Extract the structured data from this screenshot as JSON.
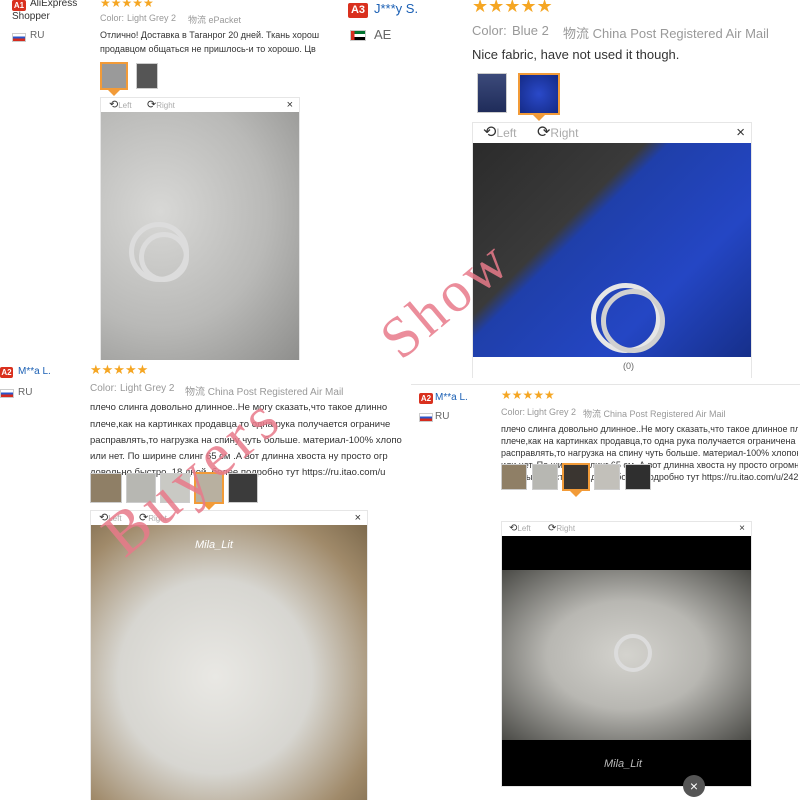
{
  "reviews": [
    {
      "badge": "A1",
      "name_line1": "AliExpress",
      "name_line2": "Shopper",
      "country": "RU",
      "stars": "★★★★★",
      "color_label": "Color:",
      "color_value": "Light Grey 2",
      "shipping": "物流 ePacket",
      "text_line1": "Отлично! Доставка в Таганрог 20 дней. Ткань хорош",
      "text_line2": "продавцом общаться не пришлось-и то хорошо. Цв",
      "viewer_left": "Left",
      "viewer_right": "Right",
      "close": "×"
    },
    {
      "badge": "A3",
      "name": "J***y S.",
      "country": "AE",
      "stars": "★★★★★",
      "color_label": "Color:",
      "color_value": "Blue 2",
      "shipping": "物流 China Post Registered Air Mail",
      "text_line1": "Nice fabric, have not used it though.",
      "viewer_left": "Left",
      "viewer_right": "Right",
      "close": "×",
      "helpful": "(0)"
    },
    {
      "badge": "A2",
      "name": "M**a L.",
      "country": "RU",
      "stars": "★★★★★",
      "color_label": "Color:",
      "color_value": "Light Grey 2",
      "shipping": "物流 China Post Registered Air Mail",
      "text_line1": "плечо слинга довольно длинное..Не могу сказать,что такое длинно",
      "text_line2": "плече,как на картинках продавца,то одна рука получается ограниче",
      "text_line3": "расправлять,то нагрузка на спину чуть больше. материал-100% хлопо",
      "text_line4": "или нет. По ширине слинг 65 см .А вот длинна хвоста ну просто огр",
      "text_line5": "довольно быстро. 18 дней. более подробно тут https://ru.itao.com/u",
      "viewer_left": "Left",
      "viewer_right": "Right",
      "close": "×",
      "photo_caption": "Mila_Lit"
    },
    {
      "badge": "A2",
      "name": "M**a L.",
      "country": "RU",
      "stars": "★★★★★",
      "color_label": "Color:",
      "color_value": "Light Grey 2",
      "shipping": "物流 China Post Registered Air Mail",
      "text_line1": "плечо слинга довольно длинное..Не могу сказать,что такое длинное пле",
      "text_line2": "плече,как на картинках продавца,то одна рука получается ограничена",
      "text_line3": "расправлять,то нагрузка на спину чуть больше. материал-100% хлопок",
      "text_line4": "или нет. По ширине слинг 65 см .А вот длинна хвоста ну просто огромн",
      "text_line5": "довольно быстро. 18 дней. более подробно тут https://ru.itao.com/u/242",
      "viewer_left": "Left",
      "viewer_right": "Right",
      "close": "×",
      "photo_caption": "Mila_Lit"
    }
  ],
  "watermark_word1": "Buyers",
  "watermark_word2": "Show",
  "colors": {
    "badge": "#d9301e",
    "stars": "#f5a623",
    "active_thumb": "#f29b38",
    "watermark": "#e87a8a",
    "name_link": "#1a5fb4"
  }
}
